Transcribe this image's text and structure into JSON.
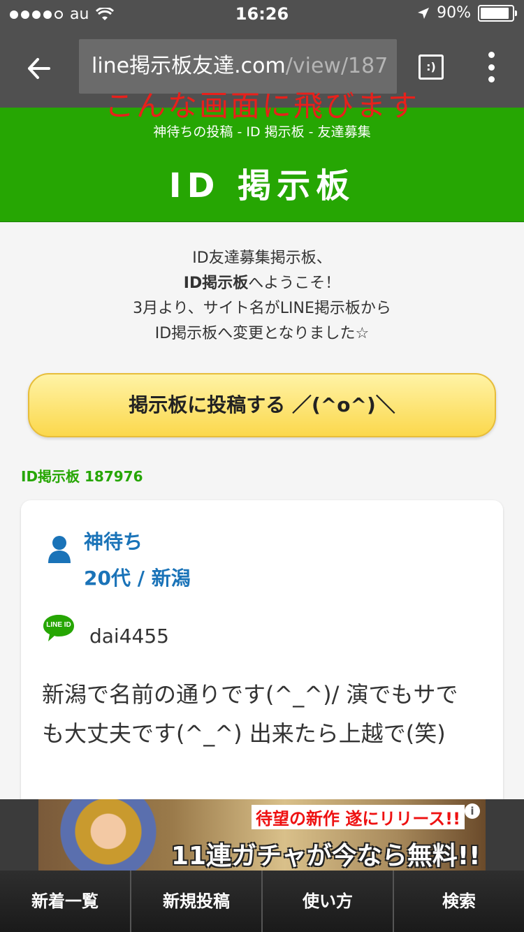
{
  "status_bar": {
    "carrier": "au",
    "time": "16:26",
    "battery": "90%",
    "battery_level": 0.9
  },
  "browser": {
    "url_host": "line掲示板友達.com",
    "url_path": "/view/187",
    "tab_button": ":)"
  },
  "overlay_caption": "こんな画面に飛びます",
  "header": {
    "subtitle": "神待ちの投稿 - ID 掲示板 - 友達募集",
    "logo": "ID 掲示板"
  },
  "intro": {
    "line1": "ID友達募集掲示板、",
    "line2_bold": "ID掲示板",
    "line2_rest": "へようこそ！",
    "line3": "3月より、サイト名がLINE掲示板から",
    "line4": "ID掲示板へ変更となりました☆"
  },
  "post_button": "掲示板に投稿する ／(^o^)＼",
  "board_id": "ID掲示板 187976",
  "post": {
    "name": "神待ち",
    "meta": "20代 / 新潟",
    "line_id": "dai4455",
    "line_badge": "LINE ID",
    "body": "新潟で名前の通りです(^_^)/ 演でもサでも大丈夫です(^_^) 出来たら上越で(笑)"
  },
  "ad": {
    "line1": "待望の新作 遂にリリース!!",
    "line2": "11連ガチャが今なら無料!!",
    "info": "i"
  },
  "bottom_nav": [
    "新着一覧",
    "新規投稿",
    "使い方",
    "検索"
  ]
}
